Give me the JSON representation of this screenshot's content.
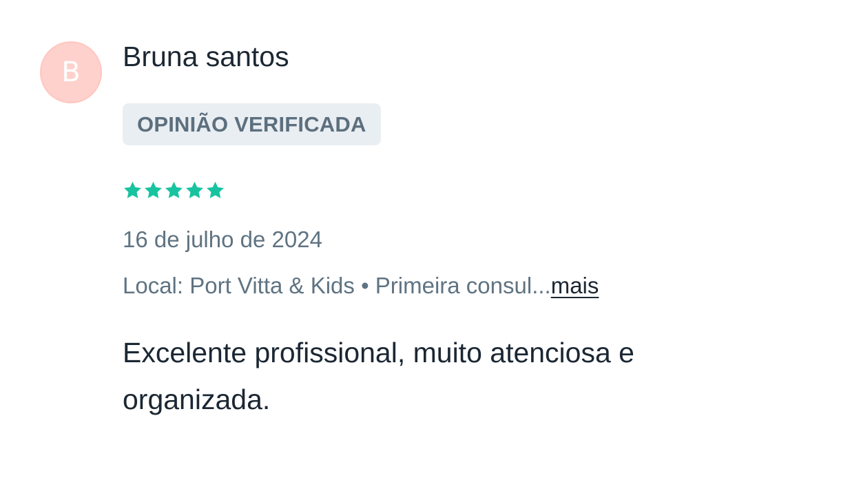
{
  "review": {
    "avatar_letter": "B",
    "author_name": "Bruna santos",
    "verified_label": "OPINIÃO VERIFICADA",
    "rating": 5,
    "rating_max": 5,
    "date": "16 de julho de 2024",
    "meta_text": "Local: Port Vitta & Kids • Primeira consul...",
    "more_label": "mais",
    "text": "Excelente profissional, muito atenciosa e organizada."
  },
  "colors": {
    "star": "#18c3a0",
    "avatar_bg": "#ffd1cc",
    "badge_bg": "#e9eef2"
  },
  "icons": {
    "star": "star-icon"
  }
}
